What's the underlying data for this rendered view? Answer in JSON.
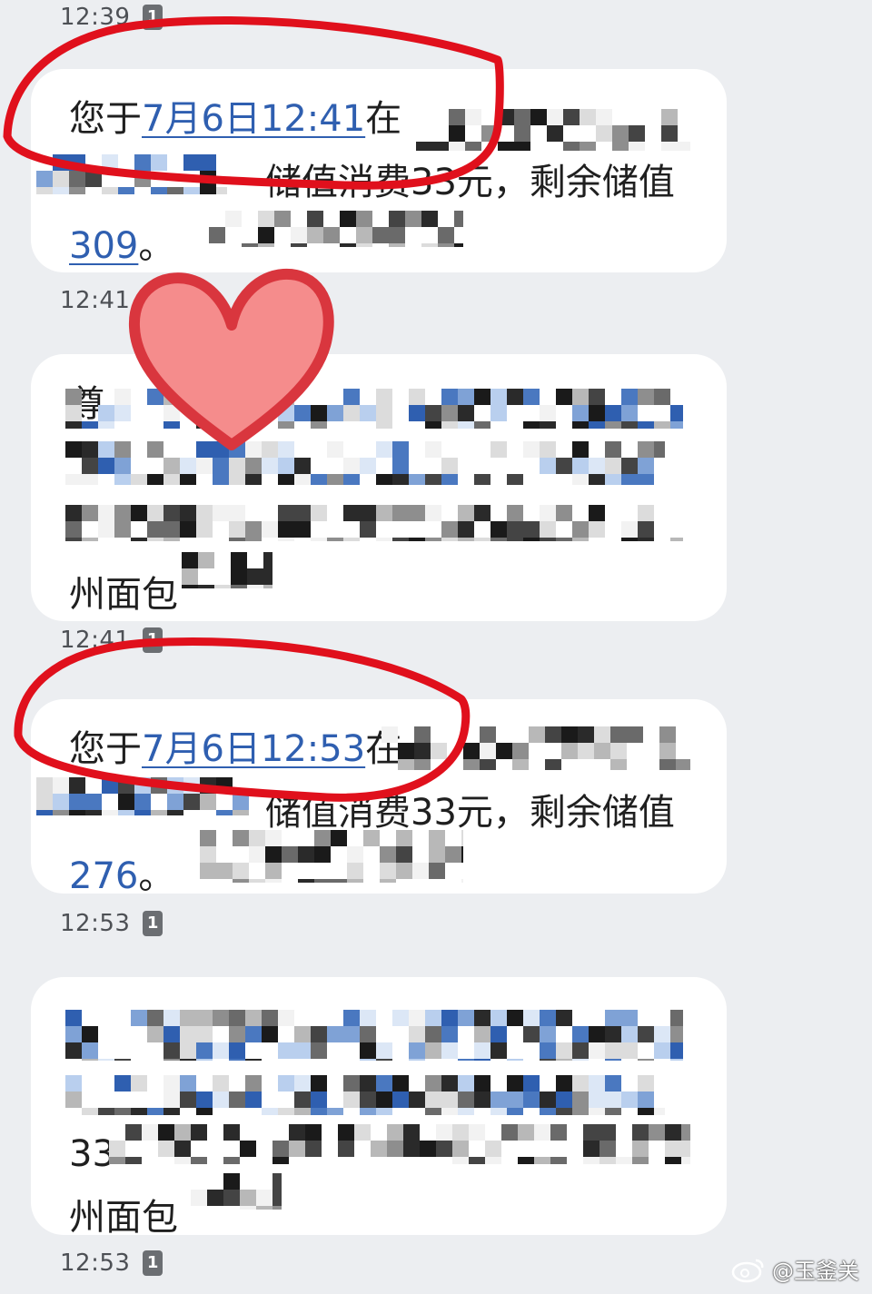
{
  "messages": [
    {
      "time": "12:39",
      "sim": "1",
      "lines": [
        {
          "text": "您于",
          "link": "7月6日12:41",
          "after": "在"
        },
        {
          "text": "储值消费33元，剩余储值",
          "link": "",
          "after": ""
        },
        {
          "text": "",
          "link": "309",
          "after": "。"
        }
      ]
    },
    {
      "time": "12:41",
      "sim": "1",
      "lines": [
        {
          "text": "尊",
          "link": "",
          "after": ""
        },
        {
          "text": "",
          "link": "",
          "after": ""
        },
        {
          "text": "",
          "link": "",
          "after": ""
        },
        {
          "text": "州面包",
          "link": "",
          "after": ""
        }
      ]
    },
    {
      "time": "12:41",
      "sim": "1",
      "lines": [
        {
          "text": "您于",
          "link": "7月6日12:53",
          "after": "在"
        },
        {
          "text": "储值消费33元，剩余储值",
          "link": "",
          "after": ""
        },
        {
          "text": "",
          "link": "276",
          "after": "。"
        }
      ]
    },
    {
      "time": "12:53",
      "sim": "1",
      "lines": [
        {
          "text": "",
          "link": "",
          "after": ""
        },
        {
          "text": "",
          "link": "",
          "after": ""
        },
        {
          "text": "33",
          "link": "",
          "after": ""
        },
        {
          "text": "州面包",
          "link": "",
          "after": ""
        }
      ]
    }
  ],
  "last_time": "12:53",
  "last_sim": "1",
  "watermark": "@玉釜关",
  "colors": {
    "background": "#eceef1",
    "bubble": "#ffffff",
    "link": "#2f5fb0",
    "annotation_red": "#e0101c",
    "heart_fill": "#f58c8c"
  }
}
